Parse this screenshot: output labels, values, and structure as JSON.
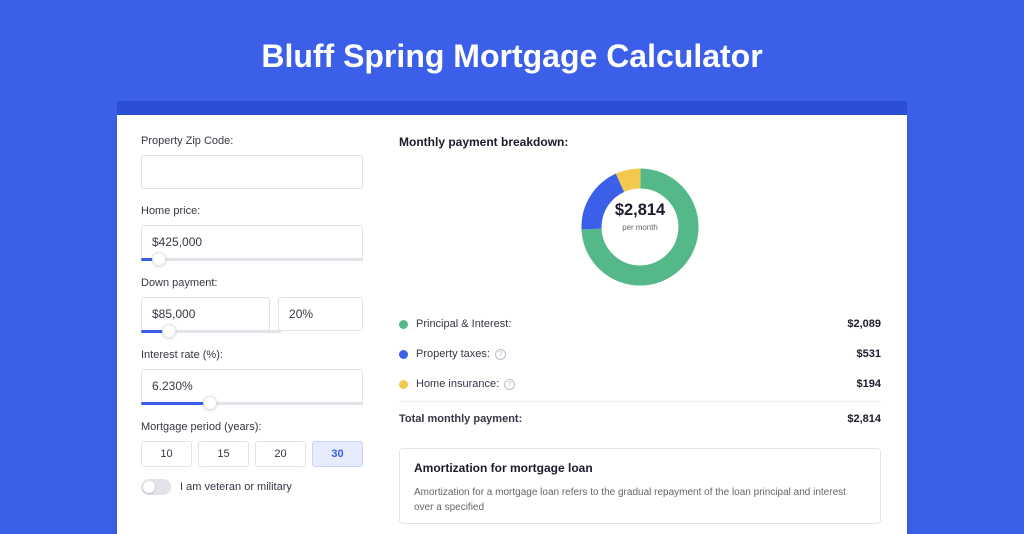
{
  "title": "Bluff Spring Mortgage Calculator",
  "form": {
    "zip_label": "Property Zip Code:",
    "zip_value": "",
    "home_price_label": "Home price:",
    "home_price_value": "$425,000",
    "home_price_slider_pct": 8,
    "down_payment_label": "Down payment:",
    "down_payment_amount": "$85,000",
    "down_payment_percent": "20%",
    "down_payment_slider_pct": 20,
    "interest_rate_label": "Interest rate (%):",
    "interest_rate_value": "6.230%",
    "interest_rate_slider_pct": 31,
    "mortgage_period_label": "Mortgage period (years):",
    "periods": [
      "10",
      "15",
      "20",
      "30"
    ],
    "period_selected": "30",
    "veteran_label": "I am veteran or military"
  },
  "breakdown": {
    "title": "Monthly payment breakdown:",
    "total_amount": "$2,814",
    "total_sub": "per month",
    "items": [
      {
        "label": "Principal & Interest:",
        "value": "$2,089",
        "color": "#54B889",
        "has_info": false
      },
      {
        "label": "Property taxes:",
        "value": "$531",
        "color": "#3B5FE8",
        "has_info": true
      },
      {
        "label": "Home insurance:",
        "value": "$194",
        "color": "#F2C94C",
        "has_info": true
      }
    ],
    "total_label": "Total monthly payment:",
    "total_value": "$2,814"
  },
  "chart_data": {
    "type": "pie",
    "title": "Monthly payment breakdown",
    "series": [
      {
        "name": "Principal & Interest",
        "value": 2089,
        "color": "#54B889"
      },
      {
        "name": "Property taxes",
        "value": 531,
        "color": "#3B5FE8"
      },
      {
        "name": "Home insurance",
        "value": 194,
        "color": "#F2C94C"
      }
    ],
    "total": 2814,
    "center_label": "$2,814",
    "center_sub": "per month"
  },
  "amortization": {
    "title": "Amortization for mortgage loan",
    "body": "Amortization for a mortgage loan refers to the gradual repayment of the loan principal and interest over a specified"
  }
}
